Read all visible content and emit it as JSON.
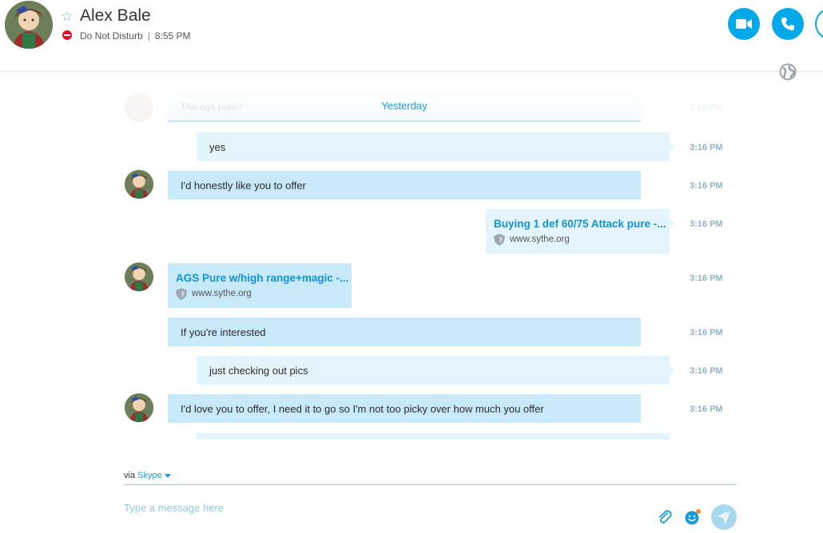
{
  "header": {
    "contact_name": "Alex Bale",
    "status": "Do Not Disturb",
    "separator": "|",
    "time": "8:55 PM",
    "icons": [
      "star-icon",
      "do-not-disturb-icon",
      "video-call-icon",
      "audio-call-icon",
      "more-icon",
      "globe-icon"
    ]
  },
  "chat": {
    "faded_previous_message": "The ags pure?",
    "day_separator": "Yesterday",
    "messages": [
      {
        "direction": "out",
        "type": "text",
        "text": "yes",
        "time": "3:16 PM"
      },
      {
        "direction": "in",
        "type": "text",
        "text": "I'd honestly like you to offer",
        "time": "3:16 PM",
        "avatar": true
      },
      {
        "direction": "out",
        "type": "link",
        "title": "Buying 1 def 60/75 Attack pure -...",
        "host": "www.sythe.org",
        "time": "3:16 PM"
      },
      {
        "direction": "in",
        "type": "link",
        "title": "AGS Pure w/high range+magic -...",
        "host": "www.sythe.org",
        "time": "3:16 PM",
        "avatar": true
      },
      {
        "direction": "in",
        "type": "text",
        "text": "If you're interested",
        "time": "3:16 PM"
      },
      {
        "direction": "out",
        "type": "text",
        "text": "just checking out pics",
        "time": "3:16 PM"
      },
      {
        "direction": "in",
        "type": "text",
        "text": "I'd love you to offer, I need it to go so I'm not too picky over how much you offer",
        "time": "3:16 PM",
        "avatar": true
      }
    ]
  },
  "composer": {
    "via_label": "via",
    "via_service": "Skype",
    "placeholder": "Type a message here"
  },
  "colors": {
    "accent": "#00a8e8",
    "incoming_bubble": "#c8e9f9",
    "outgoing_bubble": "#e4f4fc",
    "dnd_red": "#e4102a",
    "link_title": "#1292d4"
  }
}
